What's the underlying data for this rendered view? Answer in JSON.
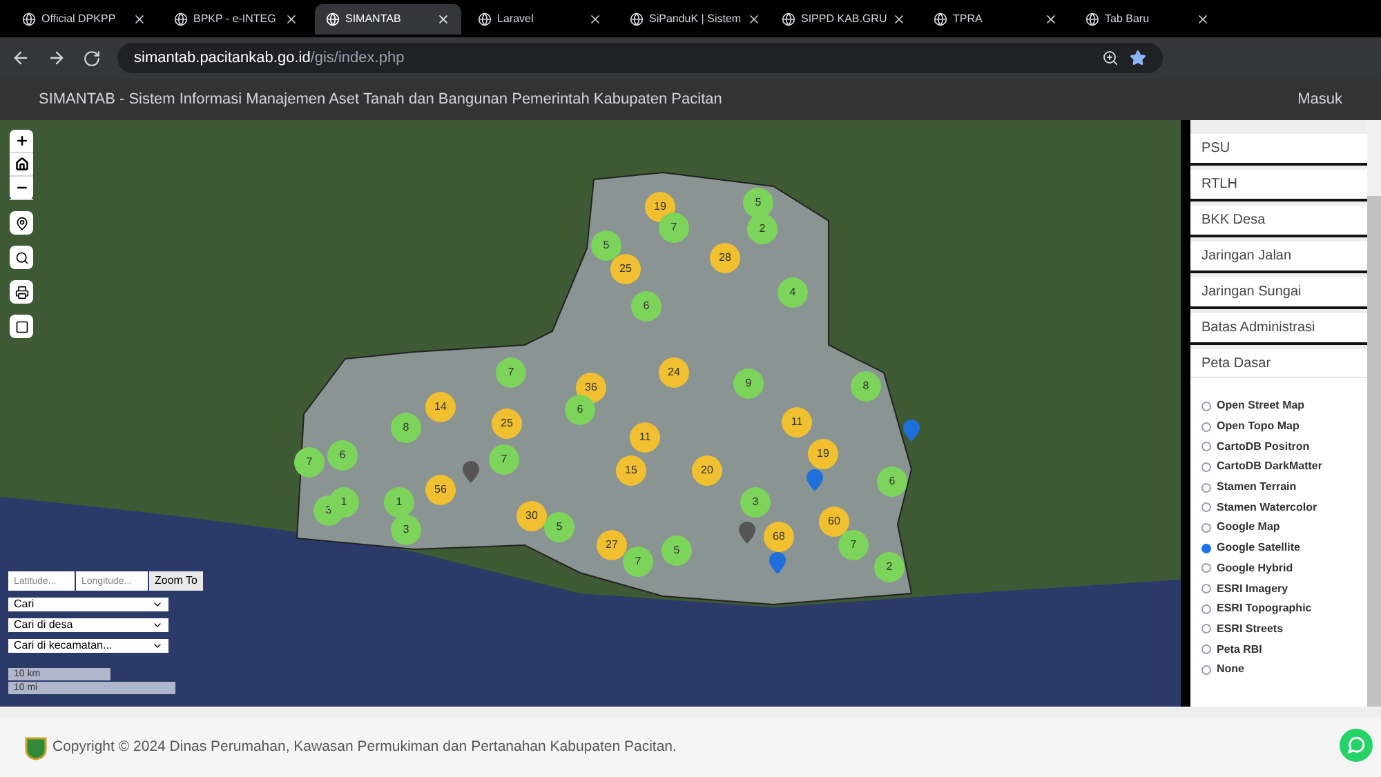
{
  "browser": {
    "tabs": [
      {
        "title": "Official DPKPP",
        "selected": false
      },
      {
        "title": "BPKP - e-INTEG",
        "selected": false
      },
      {
        "title": "SIMANTAB",
        "selected": true
      },
      {
        "title": "Laravel",
        "selected": false
      },
      {
        "title": "SiPanduK | Sistem",
        "selected": false
      },
      {
        "title": "SIPPD KAB.GRU",
        "selected": false
      },
      {
        "title": "TPRA",
        "selected": false
      },
      {
        "title": "Tab Baru",
        "selected": false
      }
    ],
    "url_host": "simantab.pacitankab.go.id",
    "url_path": "/gis/index.php"
  },
  "header": {
    "title": "SIMANTAB - Sistem Informasi Manajemen Aset Tanah dan Bangunan Pemerintah Kabupaten Pacitan",
    "login": "Masuk"
  },
  "map": {
    "clusters": [
      {
        "count": "19",
        "color": "#f0c030"
      },
      {
        "count": "5",
        "color": "#7cd45a"
      },
      {
        "count": "7",
        "color": "#7cd45a"
      },
      {
        "count": "2",
        "color": "#7cd45a"
      },
      {
        "count": "5",
        "color": "#7cd45a"
      },
      {
        "count": "25",
        "color": "#f0c030"
      },
      {
        "count": "28",
        "color": "#f0c030"
      },
      {
        "count": "4",
        "color": "#7cd45a"
      },
      {
        "count": "6",
        "color": "#7cd45a"
      },
      {
        "count": "7",
        "color": "#7cd45a"
      },
      {
        "count": "36",
        "color": "#f0c030"
      },
      {
        "count": "24",
        "color": "#f0c030"
      },
      {
        "count": "9",
        "color": "#7cd45a"
      },
      {
        "count": "8",
        "color": "#7cd45a"
      },
      {
        "count": "14",
        "color": "#f0c030"
      },
      {
        "count": "6",
        "color": "#7cd45a"
      },
      {
        "count": "8",
        "color": "#7cd45a"
      },
      {
        "count": "25",
        "color": "#f0c030"
      },
      {
        "count": "11",
        "color": "#f0c030"
      },
      {
        "count": "11",
        "color": "#f0c030"
      },
      {
        "count": "7",
        "color": "#7cd45a"
      },
      {
        "count": "6",
        "color": "#7cd45a"
      },
      {
        "count": "7",
        "color": "#7cd45a"
      },
      {
        "count": "19",
        "color": "#f0c030"
      },
      {
        "count": "15",
        "color": "#f0c030"
      },
      {
        "count": "20",
        "color": "#f0c030"
      },
      {
        "count": "6",
        "color": "#7cd45a"
      },
      {
        "count": "56",
        "color": "#f0c030"
      },
      {
        "count": "3",
        "color": "#7cd45a"
      },
      {
        "count": "1",
        "color": "#7cd45a"
      },
      {
        "count": "1",
        "color": "#7cd45a"
      },
      {
        "count": "3",
        "color": "#7cd45a"
      },
      {
        "count": "3",
        "color": "#7cd45a"
      },
      {
        "count": "30",
        "color": "#f0c030"
      },
      {
        "count": "5",
        "color": "#7cd45a"
      },
      {
        "count": "60",
        "color": "#f0c030"
      },
      {
        "count": "27",
        "color": "#f0c030"
      },
      {
        "count": "5",
        "color": "#7cd45a"
      },
      {
        "count": "68",
        "color": "#f0c030"
      },
      {
        "count": "7",
        "color": "#7cd45a"
      },
      {
        "count": "7",
        "color": "#7cd45a"
      },
      {
        "count": "2",
        "color": "#7cd45a"
      }
    ],
    "pins": [
      {
        "color": "#1e6fd9"
      },
      {
        "color": "#1e6fd9"
      },
      {
        "color": "#1e6fd9"
      },
      {
        "color": "#555555"
      },
      {
        "color": "#555555"
      }
    ],
    "coordinate_search": {
      "latitude_placeholder": "Latitude...",
      "longitude_placeholder": "Longitude...",
      "button": "Zoom To"
    },
    "selects": [
      "Cari",
      "Cari di desa",
      "Cari di kecamatan..."
    ],
    "scale": [
      "10 km",
      "10 mi"
    ]
  },
  "layers": [
    {
      "label": "PSU",
      "expanded": false
    },
    {
      "label": "RTLH",
      "expanded": false
    },
    {
      "label": "BKK Desa",
      "expanded": false
    },
    {
      "label": "Jaringan Jalan",
      "expanded": false
    },
    {
      "label": "Jaringan Sungai",
      "expanded": false
    },
    {
      "label": "Batas Administrasi",
      "expanded": false
    },
    {
      "label": "Peta Dasar",
      "expanded": true
    }
  ],
  "basemaps": [
    {
      "label": "Open Street Map",
      "selected": false
    },
    {
      "label": "Open Topo Map",
      "selected": false
    },
    {
      "label": "CartoDB Positron",
      "selected": false
    },
    {
      "label": "CartoDB DarkMatter",
      "selected": false
    },
    {
      "label": "Stamen Terrain",
      "selected": false
    },
    {
      "label": "Stamen Watercolor",
      "selected": false
    },
    {
      "label": "Google Map",
      "selected": false
    },
    {
      "label": "Google Satellite",
      "selected": true
    },
    {
      "label": "Google Hybrid",
      "selected": false
    },
    {
      "label": "ESRI Imagery",
      "selected": false
    },
    {
      "label": "ESRI Topographic",
      "selected": false
    },
    {
      "label": "ESRI Streets",
      "selected": false
    },
    {
      "label": "Peta RBI",
      "selected": false
    },
    {
      "label": "None",
      "selected": false
    }
  ],
  "footer": {
    "copyright": "Copyright © 2024 Dinas Perumahan, Kawasan Permukiman dan Pertanahan Kabupaten Pacitan."
  }
}
